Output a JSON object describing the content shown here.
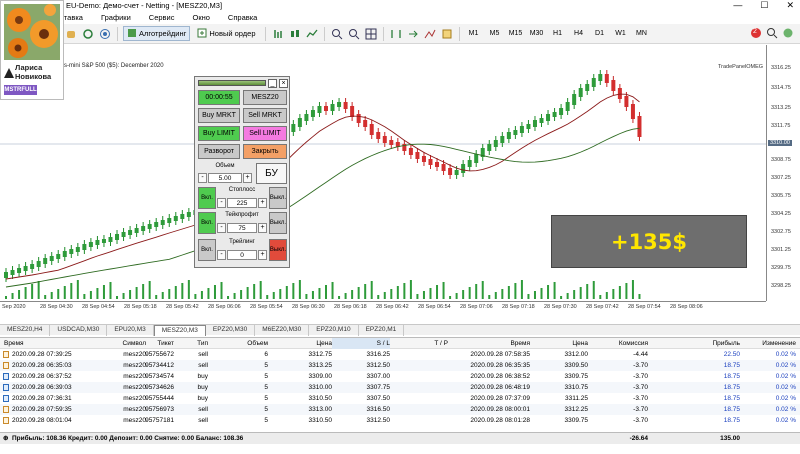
{
  "window": {
    "title": "EU-Demo: Демо-счет - Netting - [MESZ20,M3]"
  },
  "menu": [
    "стaвка",
    "Графики",
    "Сервис",
    "Окно",
    "Справка"
  ],
  "toolbar": {
    "algo_label": "Алготрейдинг",
    "new_order_label": "Новый ордер",
    "timeframes": [
      "M1",
      "M5",
      "M15",
      "M30",
      "H1",
      "H4",
      "D1",
      "W1",
      "MN"
    ],
    "badge_count": "2"
  },
  "user": {
    "first_name": "Лариса",
    "last_name": "Новикова",
    "badge": "MSTRFULL"
  },
  "chart": {
    "title": "s-mini S&P 500 ($5): December 2020",
    "panel_label": "TradePanelOMEG",
    "price_labels": [
      "3316.25",
      "3314.75",
      "3313.25",
      "3311.75",
      "3310.00",
      "3308.75",
      "3307.25",
      "3305.75",
      "3304.25",
      "3302.75",
      "3301.25",
      "3299.75",
      "3298.25"
    ],
    "current_price": "3310.00",
    "time_labels": [
      "Sep 2020",
      "28 Sep 04:30",
      "28 Sep 04:54",
      "28 Sep 05:18",
      "28 Sep 05:42",
      "28 Sep 06:06",
      "28 Sep 06:30",
      "28 Sep 06:54",
      "28 Sep 07:18",
      "28 Sep 07:42",
      "28 Sep 08:06",
      "28 Sep 05:54",
      "28 Sep 06:18",
      "28 Sep 06:42",
      "28 Sep 07:06",
      "28 Sep 07:30",
      "28 Sep 07:54"
    ]
  },
  "trade_panel": {
    "timer": "00:00:55",
    "symbol": "MESZ20",
    "buy_market": "Buy MRKT",
    "sell_market": "Sell MRKT",
    "buy_limit": "Buy LIMIT",
    "sell_limit": "Sell LIMIT",
    "reverse": "Разворот",
    "close": "Закрыть",
    "volume_label": "Объем",
    "volume": "5.00",
    "breakeven": "БУ",
    "stoploss_label": "Стоплосс",
    "stoploss": "225",
    "takeprofit_label": "Тейкпрофит",
    "takeprofit": "75",
    "trailing_label": "Трейлинг",
    "trailing": "0",
    "on": "Вкл.",
    "off": "Выкл.",
    "minus": "-",
    "plus": "+"
  },
  "profit_overlay": "+135$",
  "tabs": [
    "MESZ20,H4",
    "USDCAD,M30",
    "EPU20,M3",
    "MESZ20,M3",
    "EPZ20,M30",
    "M6EZ20,M30",
    "EPZ20,M10",
    "EPZ20,M1"
  ],
  "active_tab_index": 3,
  "table": {
    "headers": {
      "time": "Время",
      "symbol": "Символ",
      "ticket": "Тикет",
      "type": "Тип",
      "volume": "Объем",
      "price": "Цена",
      "sl": "S / L",
      "tp": "T / P",
      "time2": "Время",
      "price2": "Цена",
      "commission": "Комиссия",
      "profit": "Прибыль",
      "change": "Изменение"
    },
    "rows": [
      {
        "time": "2020.09.28 07:39:25",
        "symbol": "mesz20",
        "ticket": "95755672",
        "type": "sell",
        "volume": "6",
        "price": "3312.75",
        "sl": "3316.25",
        "time2": "2020.09.28 07:58:35",
        "price2": "3312.00",
        "commission": "-4.44",
        "profit": "22.50",
        "change": "0.02 %"
      },
      {
        "time": "2020.09.28 06:35:03",
        "symbol": "mesz20",
        "ticket": "95734412",
        "type": "sell",
        "volume": "5",
        "price": "3313.25",
        "sl": "3312.50",
        "time2": "2020.09.28 06:35:35",
        "price2": "3309.50",
        "commission": "-3.70",
        "profit": "18.75",
        "change": "0.02 %"
      },
      {
        "time": "2020.09.28 06:37:52",
        "symbol": "mesz20",
        "ticket": "95734574",
        "type": "buy",
        "volume": "5",
        "price": "3309.00",
        "sl": "3307.00",
        "time2": "2020.09.28 06:38:52",
        "price2": "3309.75",
        "commission": "-3.70",
        "profit": "18.75",
        "change": "0.02 %"
      },
      {
        "time": "2020.09.28 06:39:03",
        "symbol": "mesz20",
        "ticket": "95734626",
        "type": "buy",
        "volume": "5",
        "price": "3310.00",
        "sl": "3307.75",
        "time2": "2020.09.28 06:48:19",
        "price2": "3310.75",
        "commission": "-3.70",
        "profit": "18.75",
        "change": "0.02 %"
      },
      {
        "time": "2020.09.28 07:36:31",
        "symbol": "mesz20",
        "ticket": "95755444",
        "type": "buy",
        "volume": "5",
        "price": "3310.50",
        "sl": "3307.50",
        "time2": "2020.09.28 07:37:09",
        "price2": "3311.25",
        "commission": "-3.70",
        "profit": "18.75",
        "change": "0.02 %"
      },
      {
        "time": "2020.09.28 07:59:35",
        "symbol": "mesz20",
        "ticket": "95756973",
        "type": "sell",
        "volume": "5",
        "price": "3313.00",
        "sl": "3316.50",
        "time2": "2020.09.28 08:00:01",
        "price2": "3312.25",
        "commission": "-3.70",
        "profit": "18.75",
        "change": "0.02 %"
      },
      {
        "time": "2020.09.28 08:01:04",
        "symbol": "mesz20",
        "ticket": "95757181",
        "type": "sell",
        "volume": "5",
        "price": "3310.50",
        "sl": "3312.50",
        "time2": "2020.09.28 08:01:28",
        "price2": "3309.75",
        "commission": "-3.70",
        "profit": "18.75",
        "change": "0.02 %"
      }
    ],
    "footer": {
      "summary": "Прибыль: 108.36  Кредит: 0.00  Депозит: 0.00  Снятие: 0.00  Баланс: 108.36",
      "commission_total": "-26.64",
      "profit_total": "135.00"
    }
  }
}
